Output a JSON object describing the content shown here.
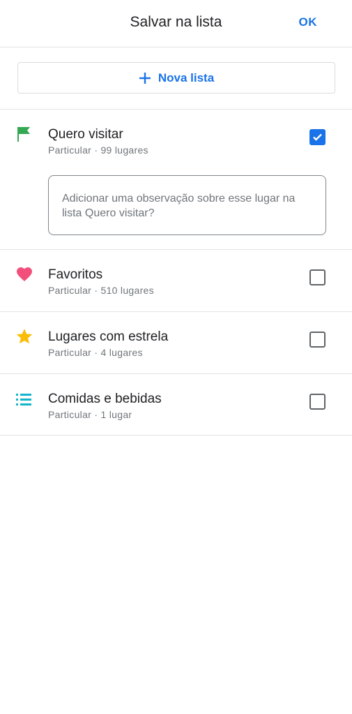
{
  "header": {
    "title": "Salvar na lista",
    "ok_label": "OK"
  },
  "new_list": {
    "label": "Nova lista",
    "icon": "plus-icon"
  },
  "note": {
    "placeholder": "Adicionar uma observação sobre esse lugar na lista Quero visitar?"
  },
  "lists": [
    {
      "title": "Quero visitar",
      "subtitle": "Particular · 99 lugares",
      "icon": "flag-icon",
      "icon_color": "#34a853",
      "checked": true
    },
    {
      "title": "Favoritos",
      "subtitle": "Particular · 510 lugares",
      "icon": "heart-icon",
      "icon_color": "#f2507b",
      "checked": false
    },
    {
      "title": "Lugares com estrela",
      "subtitle": "Particular · 4 lugares",
      "icon": "star-icon",
      "icon_color": "#fbbc04",
      "checked": false
    },
    {
      "title": "Comidas e bebidas",
      "subtitle": "Particular · 1 lugar",
      "icon": "list-icon",
      "icon_color": "#12b5cb",
      "checked": false
    }
  ],
  "colors": {
    "accent": "#1a73e8",
    "divider": "#e3e3e3"
  }
}
